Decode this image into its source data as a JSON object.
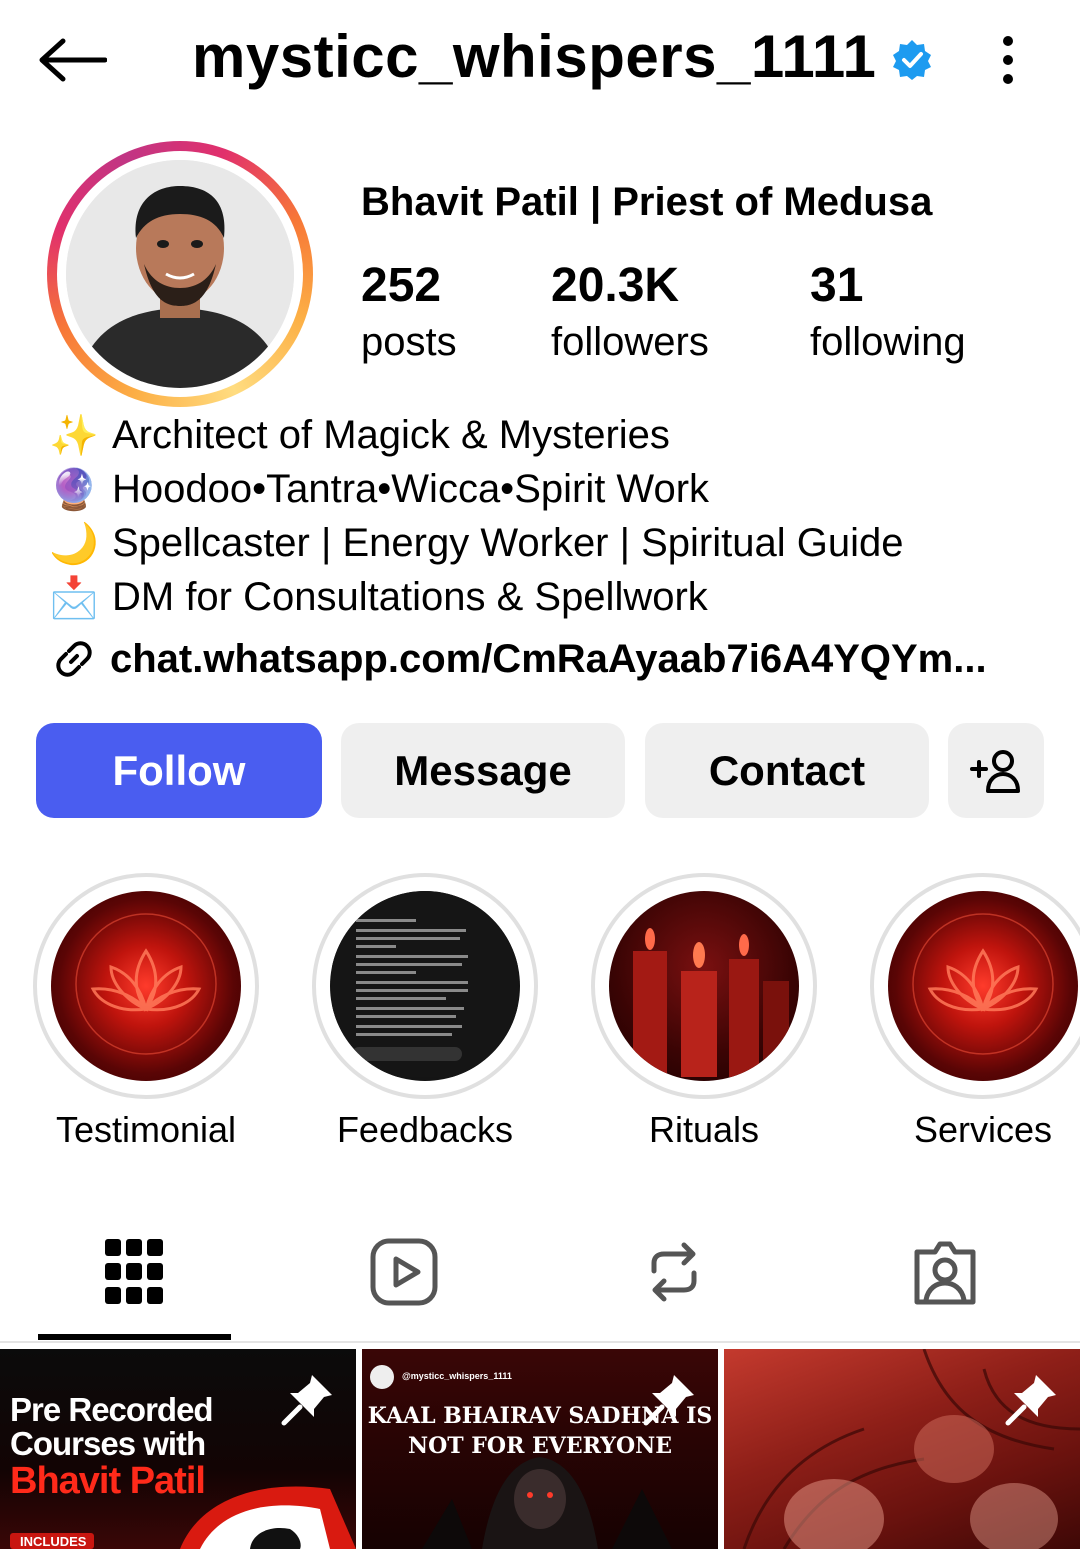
{
  "header": {
    "username": "mysticc_whispers_1111",
    "back_icon": "arrow-left-icon",
    "verified_icon": "verified-badge-icon",
    "more_icon": "more-vertical-icon"
  },
  "profile": {
    "display_name": "Bhavit Patil | Priest of Medusa",
    "stats": {
      "posts": {
        "value": "252",
        "label": "posts"
      },
      "followers": {
        "value": "20.3K",
        "label": "followers"
      },
      "following": {
        "value": "31",
        "label": "following"
      }
    },
    "bio": [
      {
        "emoji": "✨",
        "text": "Architect of Magick & Mysteries"
      },
      {
        "emoji": "🔮",
        "text": "Hoodoo•Tantra•Wicca•Spirit Work"
      },
      {
        "emoji": "🌙",
        "text": "Spellcaster | Energy Worker | Spiritual Guide"
      },
      {
        "emoji": "📩",
        "text": "DM for Consultations & Spellwork"
      }
    ],
    "link": "chat.whatsapp.com/CmRaAyaab7i6A4YQYm..."
  },
  "actions": {
    "follow": "Follow",
    "message": "Message",
    "contact": "Contact",
    "add_user_icon": "add-person-icon"
  },
  "highlights": [
    {
      "label": "Testimonial"
    },
    {
      "label": "Feedbacks"
    },
    {
      "label": "Rituals"
    },
    {
      "label": "Services"
    }
  ],
  "tabs": [
    "grid-icon",
    "reels-icon",
    "reposts-icon",
    "tagged-icon"
  ],
  "posts": [
    {
      "line1": "Pre Recorded",
      "line2": "Courses with",
      "line3": "Bhavit Patil",
      "tag": "INCLUDES"
    },
    {
      "handle": "@mysticc_whispers_1111",
      "line1": "KAAL BHAIRAV SADHNA IS",
      "line2": "NOT FOR EVERYONE"
    },
    {}
  ],
  "colors": {
    "follow_bg": "#4a5df0",
    "secondary_btn_bg": "#efefef",
    "verified": "#1d9bf0"
  }
}
